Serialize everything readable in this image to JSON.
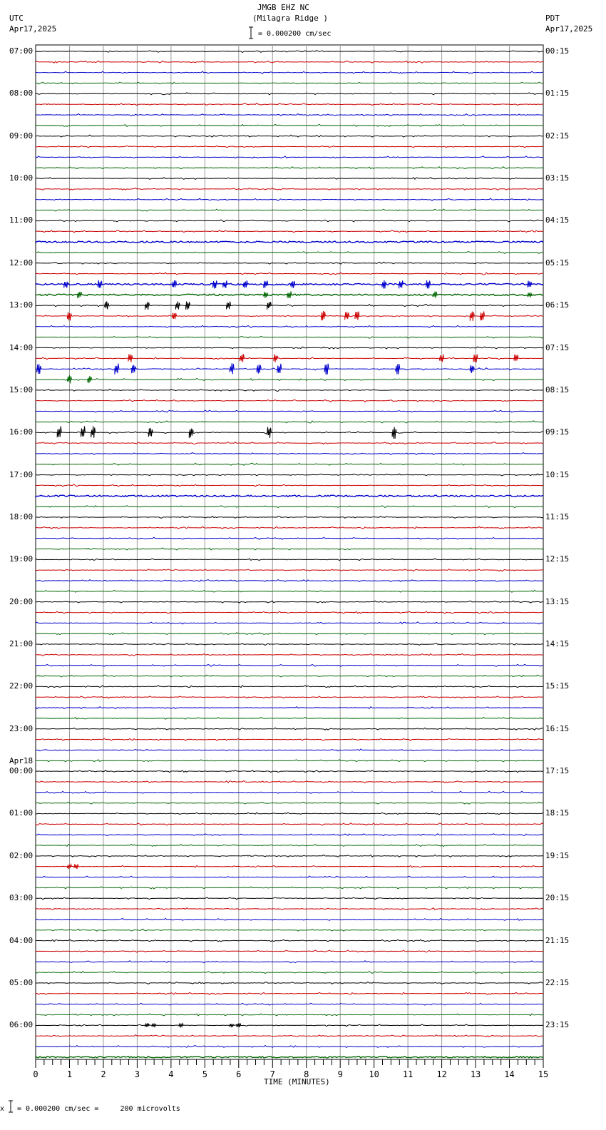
{
  "header": {
    "station": "JMGB EHZ NC",
    "location": "(Milagra Ridge )",
    "left_tz": "UTC",
    "left_date": "Apr17,2025",
    "right_tz": "PDT",
    "right_date": "Apr17,2025",
    "scale": "= 0.000200 cm/sec"
  },
  "footer": {
    "scale": "= 0.000200 cm/sec =     200 microvolts",
    "marker": "x"
  },
  "chart_data": {
    "type": "line",
    "title": "JMGB EHZ NC (Milagra Ridge )",
    "xlabel": "TIME (MINUTES)",
    "xlim": [
      0,
      15
    ],
    "x_ticks": [
      "0",
      "1",
      "2",
      "3",
      "4",
      "5",
      "6",
      "7",
      "8",
      "9",
      "10",
      "11",
      "12",
      "13",
      "14",
      "15"
    ],
    "trace_colors": [
      "#000000",
      "#cc0000",
      "#0000cc",
      "#006600"
    ],
    "traces_per_hour": 4,
    "left_labels": [
      "07:00",
      "08:00",
      "09:00",
      "10:00",
      "11:00",
      "12:00",
      "13:00",
      "14:00",
      "15:00",
      "16:00",
      "17:00",
      "18:00",
      "19:00",
      "20:00",
      "21:00",
      "22:00",
      "23:00",
      "00:00",
      "01:00",
      "02:00",
      "03:00",
      "04:00",
      "05:00",
      "06:00"
    ],
    "left_date_change": {
      "index": 17,
      "label": "Apr18"
    },
    "right_labels": [
      "00:15",
      "01:15",
      "02:15",
      "03:15",
      "04:15",
      "05:15",
      "06:15",
      "07:15",
      "08:15",
      "09:15",
      "10:15",
      "11:15",
      "12:15",
      "13:15",
      "14:15",
      "15:15",
      "16:15",
      "17:15",
      "18:15",
      "19:15",
      "20:15",
      "21:15",
      "22:15",
      "23:15"
    ],
    "noisy_traces": [
      18,
      22,
      23,
      42,
      95
    ],
    "events": [
      {
        "trace": 22,
        "minutes": [
          0.9,
          1.9,
          4.1,
          5.3,
          5.6,
          6.2,
          6.8,
          7.6,
          10.3,
          10.8,
          11.6,
          14.6
        ],
        "amp": 6
      },
      {
        "trace": 23,
        "minutes": [
          1.3,
          6.8,
          7.5,
          11.8,
          14.6
        ],
        "amp": 5
      },
      {
        "trace": 24,
        "minutes": [
          2.1,
          3.3,
          4.2,
          4.5,
          5.7,
          6.9
        ],
        "amp": 6
      },
      {
        "trace": 25,
        "minutes": [
          1.0,
          4.1,
          8.5,
          9.2,
          9.5,
          12.9,
          13.2
        ],
        "amp": 7
      },
      {
        "trace": 29,
        "minutes": [
          2.8,
          6.1,
          7.1,
          12.0,
          13.0,
          14.2
        ],
        "amp": 6
      },
      {
        "trace": 30,
        "minutes": [
          0.1,
          2.4,
          2.9,
          5.8,
          6.6,
          7.2,
          8.6,
          10.7,
          12.9
        ],
        "amp": 8
      },
      {
        "trace": 31,
        "minutes": [
          1.0,
          1.6
        ],
        "amp": 6
      },
      {
        "trace": 36,
        "minutes": [
          0.7,
          1.4,
          1.7,
          3.4,
          4.6,
          6.9,
          10.6
        ],
        "amp": 9
      },
      {
        "trace": 77,
        "minutes": [
          1.0,
          1.2
        ],
        "amp": 4
      },
      {
        "trace": 92,
        "minutes": [
          3.3,
          3.5,
          4.3,
          5.8,
          6.0
        ],
        "amp": 3
      }
    ]
  }
}
